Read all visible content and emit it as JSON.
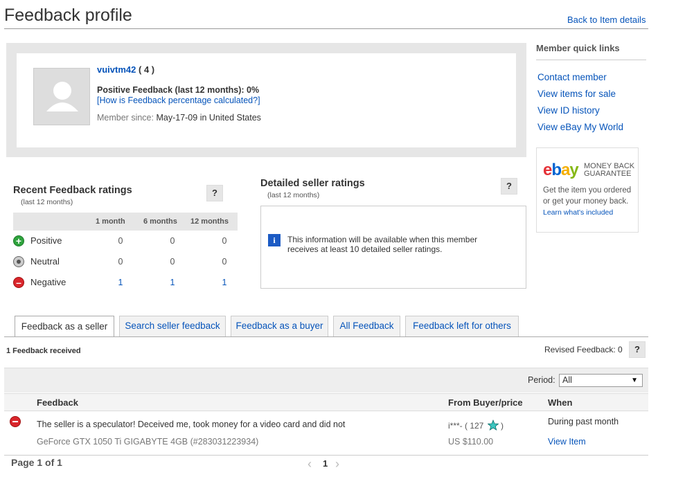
{
  "header": {
    "title": "Feedback profile",
    "back_link": "Back to Item details"
  },
  "profile": {
    "username": "vuivtm42",
    "score": "( 4 )",
    "positive_feedback": "Positive Feedback (last 12 months): 0%",
    "how_link": "[How is Feedback percentage calculated?]",
    "member_since_label": "Member since:",
    "member_since_value": "May-17-09 in United States"
  },
  "quick_links": {
    "title": "Member quick links",
    "items": [
      "Contact member",
      "View items for sale",
      "View ID history",
      "View eBay My World"
    ]
  },
  "guarantee": {
    "logo_e": "e",
    "logo_b": "b",
    "logo_a": "a",
    "logo_y": "y",
    "badge": "MONEY BACK GUARANTEE",
    "text": "Get the item you ordered or get your money back.",
    "link": "Learn what's included"
  },
  "recent": {
    "title": "Recent Feedback ratings",
    "subtitle": "(last 12 months)",
    "help": "?",
    "columns": [
      "1 month",
      "6 months",
      "12 months"
    ],
    "rows": [
      {
        "label": "Positive",
        "values": [
          "0",
          "0",
          "0"
        ],
        "color": "#2fa33d"
      },
      {
        "label": "Neutral",
        "values": [
          "0",
          "0",
          "0"
        ],
        "color": "#8a8a8a"
      },
      {
        "label": "Negative",
        "values": [
          "1",
          "1",
          "1"
        ],
        "color": "#d9252b"
      }
    ]
  },
  "dsr": {
    "title": "Detailed seller ratings",
    "subtitle": "(last 12 months)",
    "help": "?",
    "info_icon": "i",
    "message": "This information will be available when this member receives at least 10 detailed seller ratings."
  },
  "tabs": [
    "Feedback as a seller",
    "Search seller feedback",
    "Feedback as a buyer",
    "All Feedback",
    "Feedback left for others"
  ],
  "feedback": {
    "received": "1 Feedback received",
    "revised": "Revised Feedback: 0",
    "help": "?",
    "period_label": "Period:",
    "period_value": "All",
    "columns": {
      "feedback": "Feedback",
      "buyer": "From Buyer/price",
      "when": "When"
    },
    "entry": {
      "rating": "negative",
      "comment": "The seller is a speculator! Deceived me, took money for a video card and did not",
      "item": "GeForce GTX 1050 Ti GIGABYTE 4GB (#283031223934)",
      "buyer": "i***- ( 127",
      "buyer_close": ")",
      "price": "US $110.00",
      "when": "During past month",
      "view_item": "View Item"
    }
  },
  "pagination": {
    "page_text": "Page 1 of 1",
    "prev": "‹",
    "current": "1",
    "next": "›"
  }
}
